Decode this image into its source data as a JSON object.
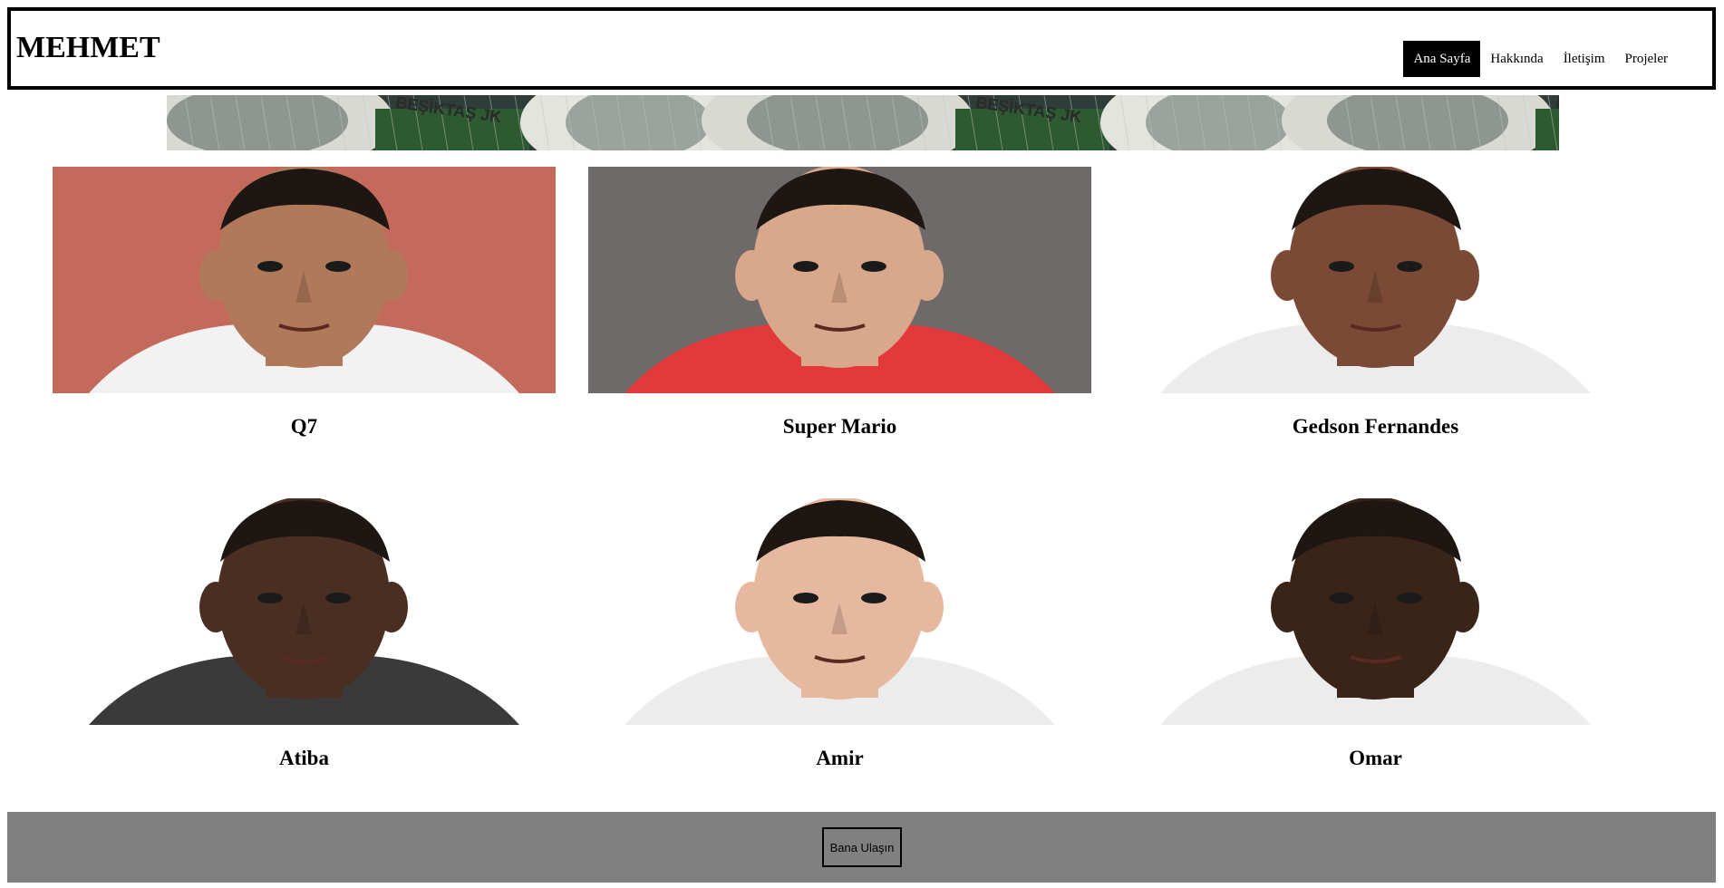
{
  "header": {
    "brand": "MEHMET",
    "nav": [
      {
        "label": "Ana Sayfa",
        "active": true
      },
      {
        "label": "Hakkında",
        "active": false
      },
      {
        "label": "İletişim",
        "active": false
      },
      {
        "label": "Projeler",
        "active": false
      }
    ]
  },
  "banner": {
    "stadium_sign": "BEŞİKTAŞ JK"
  },
  "players": [
    {
      "name": "Q7",
      "shirt_color": "#f2f2f2",
      "bg_color": "#c46a5a",
      "skin_color": "#b07a5a"
    },
    {
      "name": "Super Mario",
      "shirt_color": "#e23a3a",
      "bg_color": "#6e6a6a",
      "skin_color": "#d9a88a"
    },
    {
      "name": "Gedson Fernandes",
      "shirt_color": "#ececec",
      "bg_color": "#ffffff",
      "skin_color": "#7a4a36"
    },
    {
      "name": "Atiba",
      "shirt_color": "#3a3a3a",
      "bg_color": "#ffffff",
      "skin_color": "#4a2e22"
    },
    {
      "name": "Amir",
      "shirt_color": "#ececec",
      "bg_color": "#ffffff",
      "skin_color": "#e7b8a0"
    },
    {
      "name": "Omar",
      "shirt_color": "#ececec",
      "bg_color": "#ffffff",
      "skin_color": "#3a2418"
    }
  ],
  "footer": {
    "contact_label": "Bana Ulaşın"
  }
}
